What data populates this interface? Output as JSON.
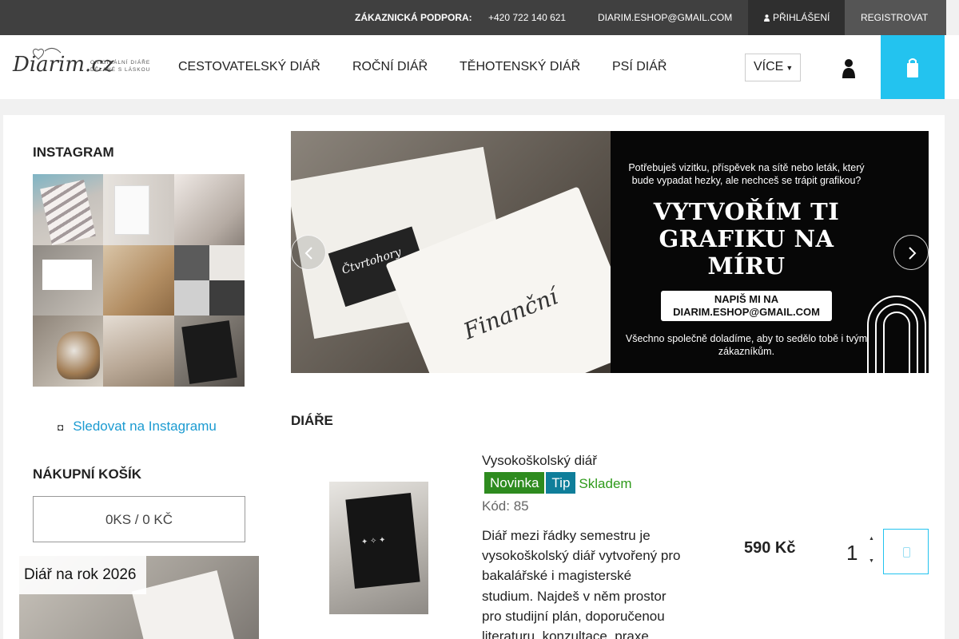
{
  "topbar": {
    "support_label": "ZÁKAZNICKÁ PODPORA:",
    "phone": "+420 722 140 621",
    "email": "DIARIM.ESHOP@GMAIL.COM",
    "login_label": "PŘIHLÁŠENÍ",
    "login_icon": "user-icon",
    "register_label": "REGISTROVAT"
  },
  "header": {
    "logo_text": "Diarim.cz",
    "logo_tagline": "ORIGINÁLNÍ DIÁŘE DĚLANÉ S LÁSKOU",
    "nav": [
      "CESTOVATELSKÝ DIÁŘ",
      "ROČNÍ DIÁŘ",
      "TĚHOTENSKÝ DIÁŘ",
      "PSÍ DIÁŘ"
    ],
    "more_label": "VÍCE",
    "user_icon": "person-icon",
    "cart_icon": "cart-icon"
  },
  "sidebar": {
    "instagram_title": "INSTAGRAM",
    "follow_label": "Sledovat na Instagramu",
    "follow_icon": "instagram-icon",
    "cart_title": "NÁKUPNÍ KOŠÍK",
    "cart_summary": "0KS / 0 KČ",
    "promo_label": "Diář na rok 2026"
  },
  "banner": {
    "intro": "Potřebuješ vizitku, příspěvek na sítě nebo leták, který bude vypadat hezky, ale nechceš se trápit grafikou?",
    "headline_1": "VYTVOŘÍM TI",
    "headline_2": "GRAFIKU NA MÍRU",
    "cta_line_1": "NAPIŠ MI NA",
    "cta_line_2": "DIARIM.ESHOP@GMAIL.COM",
    "outro": "Všechno společně doladíme, aby to sedělo tobě i tvým zákazníkům.",
    "book_text_1": "Čtvrtohory",
    "book_text_2": "Finanční",
    "prev_icon": "chevron-left-icon",
    "next_icon": "chevron-right-icon"
  },
  "products_section": {
    "title": "DIÁŘE"
  },
  "product": {
    "name": "Vysokoškolský diář",
    "badge_new": "Novinka",
    "badge_tip": "Tip",
    "stock": "Skladem",
    "code": "Kód: 85",
    "description": "Diář mezi řádky semestru je vysokoškolský diář vytvořený pro bakalářské i magisterské studium. Najdeš v něm prostor pro studijní plán, doporučenou literaturu, konzultace, praxe...",
    "price": "590 Kč",
    "quantity": "1",
    "add_icon": "cart-add-icon",
    "colors": {
      "new": "#2e8b1f",
      "tip": "#0f7e9a",
      "stock": "#2e9a1a",
      "accent": "#23c3ef"
    }
  }
}
